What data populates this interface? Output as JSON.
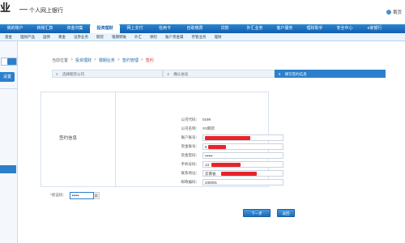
{
  "header": {
    "logo": "业",
    "title": "个人网上银行",
    "home_label": "首页"
  },
  "mainnav": {
    "items": [
      {
        "label": "我的账户"
      },
      {
        "label": "转账汇款"
      },
      {
        "label": "资金归集"
      },
      {
        "label": "投资理财",
        "active": true
      },
      {
        "label": "网上支付"
      },
      {
        "label": "信用卡"
      },
      {
        "label": "自助缴费"
      },
      {
        "label": "贷款"
      },
      {
        "label": "外汇业务"
      },
      {
        "label": "客户服务"
      },
      {
        "label": "理财助手"
      },
      {
        "label": "安全中心"
      },
      {
        "label": "e家银行"
      }
    ]
  },
  "subnav": {
    "items": [
      "基金",
      "理财产品",
      "国债",
      "黄金",
      "证券业务",
      "期货",
      "银期转账",
      "外汇",
      "保险",
      "账户贵金属",
      "存管业务",
      "理财"
    ]
  },
  "sidebar": {
    "primary_button": "设置",
    "items": [
      "",
      "",
      "",
      "",
      ""
    ],
    "active_index": 2
  },
  "breadcrumb": {
    "items": [
      "当前位置",
      "投资理财",
      "银期业务",
      "签约管理"
    ],
    "current": "签约"
  },
  "steps": [
    {
      "num": "1",
      "label": "选择期货公司"
    },
    {
      "num": "2",
      "label": "确认协议"
    },
    {
      "num": "3",
      "label": "填写签约信息",
      "active": true
    }
  ],
  "form": {
    "section_title": "签约信息",
    "company_code_label": "公司代码：",
    "company_code_value": "0199",
    "company_name_label": "公司名称：",
    "company_name_value": "XX期货",
    "account_no_label": "账户账号：",
    "fund_account_label": "资金账号：",
    "fund_account_prefix": "8",
    "fund_password_label": "资金密码：",
    "fund_password_value": "••••••",
    "phone_label": "手机号码：",
    "phone_prefix": "13",
    "address_label": "联系地址：",
    "address_prefix": "云南省",
    "postcode_label": "邮政编码：",
    "postcode_value": "230001"
  },
  "verify": {
    "label": "*验证码：",
    "value": "•••••",
    "refresh_label": "换"
  },
  "buttons": {
    "next": "下一步",
    "back": "返回"
  }
}
